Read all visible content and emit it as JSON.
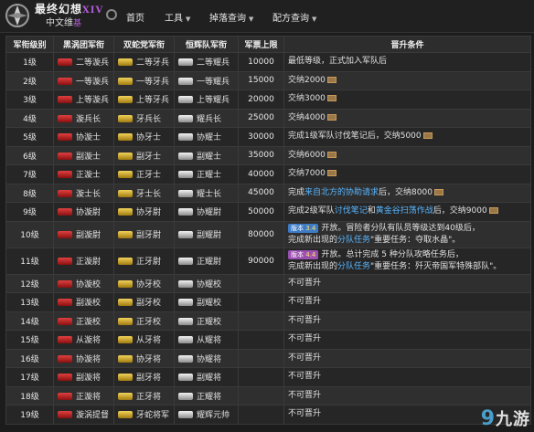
{
  "header": {
    "logo_title": "最终幻想",
    "logo_title_suffix": "XIV",
    "logo_sub": "中文维",
    "logo_sub_sup": "基",
    "nav": [
      {
        "label": "首页",
        "has_dropdown": false
      },
      {
        "label": "工具",
        "has_dropdown": true
      },
      {
        "label": "掉落查询",
        "has_dropdown": true
      },
      {
        "label": "配方查询",
        "has_dropdown": true
      }
    ]
  },
  "table": {
    "headers": [
      "军衔级别",
      "黑涡团军衔",
      "双蛇党军衔",
      "恒辉队军衔",
      "军票上限",
      "晋升条件"
    ],
    "rows": [
      {
        "rank": "1级",
        "a": "二等漩兵",
        "b": "二等牙兵",
        "c": "二等耀兵",
        "seals": "10000",
        "cond": "最低等级，正式加入军队后"
      },
      {
        "rank": "2级",
        "a": "一等漩兵",
        "b": "一等牙兵",
        "c": "一等耀兵",
        "seals": "15000",
        "cond": "交纳2000"
      },
      {
        "rank": "3级",
        "a": "上等漩兵",
        "b": "上等牙兵",
        "c": "上等耀兵",
        "seals": "20000",
        "cond": "交纳3000"
      },
      {
        "rank": "4级",
        "a": "漩兵长",
        "b": "牙兵长",
        "c": "耀兵长",
        "seals": "25000",
        "cond": "交纳4000"
      },
      {
        "rank": "5级",
        "a": "协漩士",
        "b": "协牙士",
        "c": "协耀士",
        "seals": "30000",
        "cond": "完成1级军队讨伐笔记后，交纳5000"
      },
      {
        "rank": "6级",
        "a": "副漩士",
        "b": "副牙士",
        "c": "副耀士",
        "seals": "35000",
        "cond": "交纳6000"
      },
      {
        "rank": "7级",
        "a": "正漩士",
        "b": "正牙士",
        "c": "正耀士",
        "seals": "40000",
        "cond": "交纳7000"
      },
      {
        "rank": "8级",
        "a": "漩士长",
        "b": "牙士长",
        "c": "耀士长",
        "seals": "45000",
        "cond_pre": "完成",
        "cond_hl": "来自北方的协助请求",
        "cond_post": "后，交纳8000"
      },
      {
        "rank": "9级",
        "a": "协漩尉",
        "b": "协牙尉",
        "c": "协耀尉",
        "seals": "50000",
        "cond_pre": "完成2级军队",
        "cond_hl": "讨伐笔记",
        "cond_mid": "和",
        "cond_hl2": "黄金谷扫荡作战",
        "cond_post": "后，交纳9000"
      },
      {
        "rank": "10级",
        "a": "副漩尉",
        "b": "副牙尉",
        "c": "副耀尉",
        "seals": "80000",
        "badge": "版本",
        "badge_ver": "3.4",
        "line1": "开放。冒险者分队有队员等级达到40级后，",
        "line2_pre": "完成新出现的",
        "line2_hl": "分队任务",
        "line2_post": "\"重要任务：夺取水晶\"。"
      },
      {
        "rank": "11级",
        "a": "正漩尉",
        "b": "正牙尉",
        "c": "正耀尉",
        "seals": "90000",
        "badge": "版本",
        "badge_ver": "4.4",
        "line1": "开放。总计完成 5 种分队攻略任务后，",
        "line2_pre": "完成新出现的",
        "line2_hl": "分队任务",
        "line2_post": "\"重要任务：歼灭帝国军特殊部队\"。"
      },
      {
        "rank": "12级",
        "a": "协漩校",
        "b": "协牙校",
        "c": "协耀校",
        "seals": "",
        "cond": "不可晋升"
      },
      {
        "rank": "13级",
        "a": "副漩校",
        "b": "副牙校",
        "c": "副耀校",
        "seals": "",
        "cond": "不可晋升"
      },
      {
        "rank": "14级",
        "a": "正漩校",
        "b": "正牙校",
        "c": "正耀校",
        "seals": "",
        "cond": "不可晋升"
      },
      {
        "rank": "15级",
        "a": "从漩将",
        "b": "从牙将",
        "c": "从耀将",
        "seals": "",
        "cond": "不可晋升"
      },
      {
        "rank": "16级",
        "a": "协漩将",
        "b": "协牙将",
        "c": "协耀将",
        "seals": "",
        "cond": "不可晋升"
      },
      {
        "rank": "17级",
        "a": "副漩将",
        "b": "副牙将",
        "c": "副耀将",
        "seals": "",
        "cond": "不可晋升"
      },
      {
        "rank": "18级",
        "a": "正漩将",
        "b": "正牙将",
        "c": "正耀将",
        "seals": "",
        "cond": "不可晋升"
      },
      {
        "rank": "19级",
        "a": "漩涡提督",
        "b": "牙蛇将军",
        "c": "耀辉元帅",
        "seals": "",
        "cond": "不可晋升"
      }
    ]
  },
  "watermark": {
    "prefix": "9",
    "text": "九游"
  },
  "colors": {
    "maelstrom": "#c8282a",
    "twin_adder": "#d8b030",
    "flames": "#cfcfcf",
    "link": "#58b6ff"
  }
}
